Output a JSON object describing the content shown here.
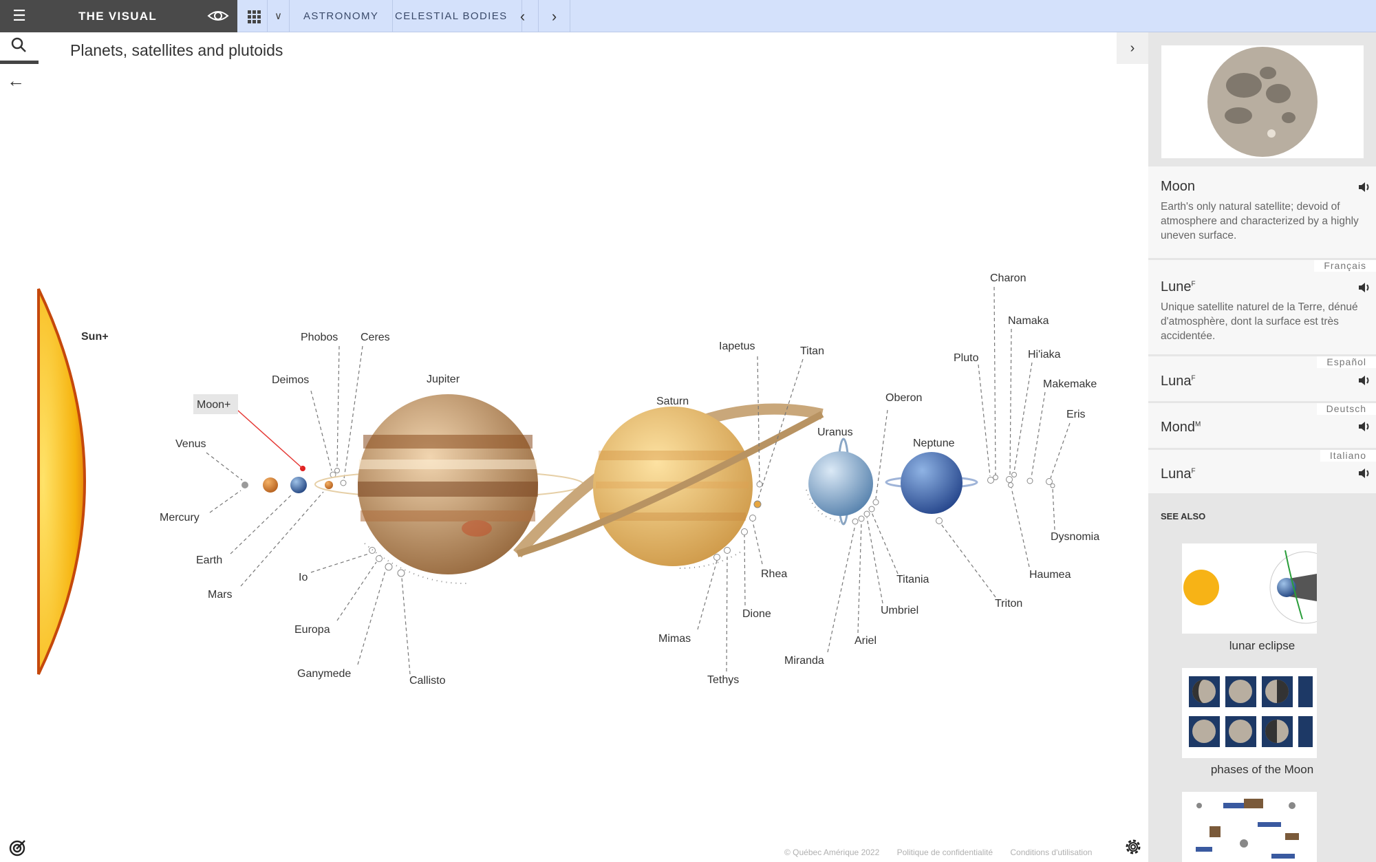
{
  "app": {
    "brand": "THE VISUAL",
    "menu_icon": "hamburger-icon",
    "view_icon": "eye-icon"
  },
  "breadcrumb": [
    "ASTRONOMY",
    "CELESTIAL BODIES"
  ],
  "page_title": "Planets, satellites and plutoids",
  "diagram": {
    "labels": {
      "sun": "Sun+",
      "moon": "Moon+",
      "venus": "Venus",
      "mercury": "Mercury",
      "earth": "Earth",
      "mars": "Mars",
      "phobos": "Phobos",
      "deimos": "Deimos",
      "ceres": "Ceres",
      "jupiter": "Jupiter",
      "io": "Io",
      "europa": "Europa",
      "ganymede": "Ganymede",
      "callisto": "Callisto",
      "saturn": "Saturn",
      "iapetus": "Iapetus",
      "titan": "Titan",
      "rhea": "Rhea",
      "dione": "Dione",
      "mimas": "Mimas",
      "tethys": "Tethys",
      "uranus": "Uranus",
      "oberon": "Oberon",
      "titania": "Titania",
      "umbriel": "Umbriel",
      "ariel": "Ariel",
      "miranda": "Miranda",
      "neptune": "Neptune",
      "triton": "Triton",
      "pluto": "Pluto",
      "charon": "Charon",
      "namaka": "Namaka",
      "hiiaka": "Hi'iaka",
      "makemake": "Makemake",
      "eris": "Eris",
      "dysnomia": "Dysnomia",
      "haumea": "Haumea"
    }
  },
  "panel": {
    "term": {
      "name": "Moon",
      "definition": "Earth's only natural satellite; devoid of atmosphere and characterized by a highly uneven surface."
    },
    "translations": [
      {
        "lang": "Français",
        "name": "Lune",
        "gender": "F",
        "definition": "Unique satellite naturel de la Terre, dénué d'atmosphère, dont la surface est très accidentée."
      },
      {
        "lang": "Español",
        "name": "Luna",
        "gender": "F"
      },
      {
        "lang": "Deutsch",
        "name": "Mond",
        "gender": "M"
      },
      {
        "lang": "Italiano",
        "name": "Luna",
        "gender": "F"
      }
    ],
    "see_also_title": "SEE ALSO",
    "see_also": [
      "lunar eclipse",
      "phases of the Moon"
    ]
  },
  "footer": {
    "copyright": "© Québec Amérique 2022",
    "privacy": "Politique de confidentialité",
    "terms": "Conditions d'utilisation"
  },
  "colors": {
    "topbar": "#d4e1fb",
    "brand_bg": "#4a4a4a",
    "panel_bg": "#e6e6e6",
    "highlight_line": "#e53935"
  }
}
